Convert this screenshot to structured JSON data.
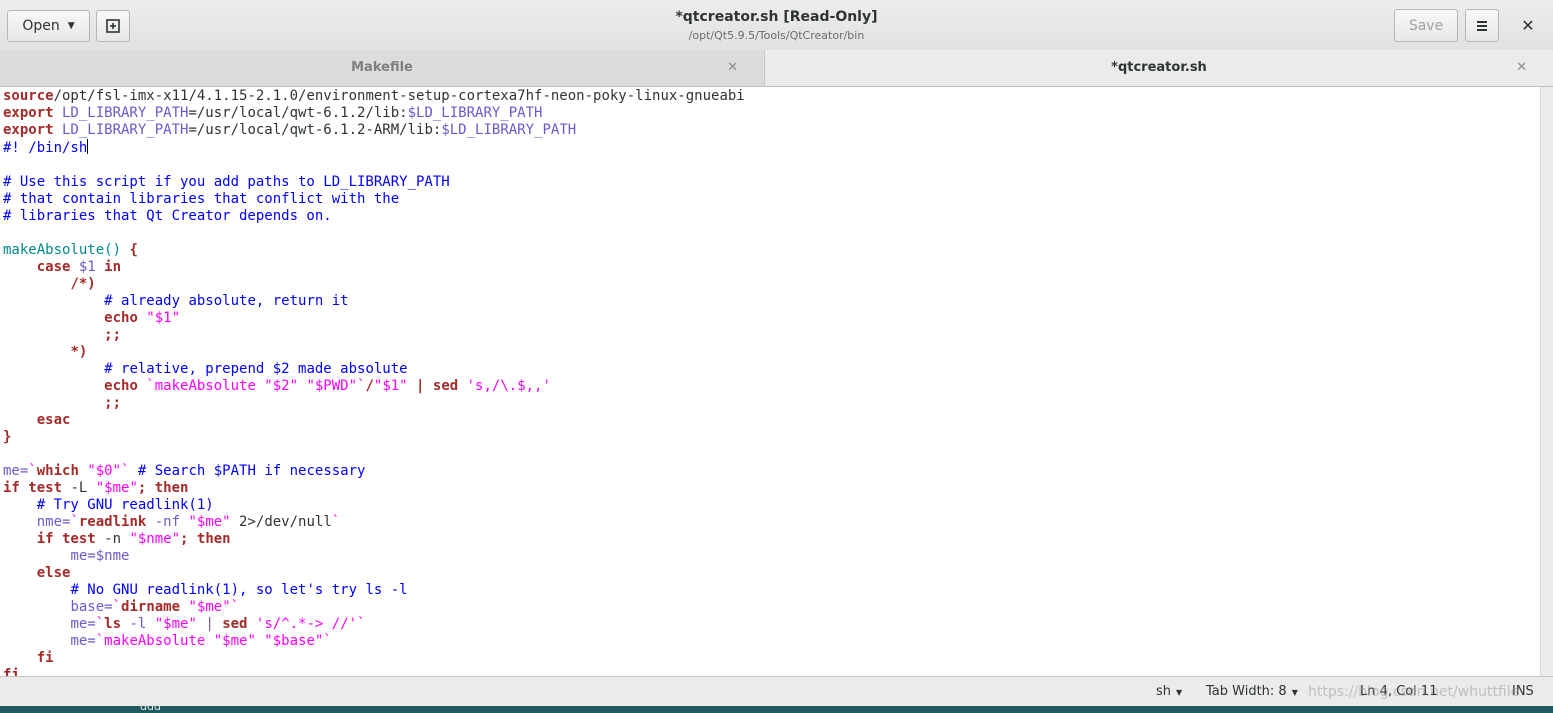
{
  "window": {
    "title": "*qtcreator.sh [Read-Only]",
    "subtitle": "/opt/Qt5.9.5/Tools/QtCreator/bin",
    "open_label": "Open",
    "save_label": "Save",
    "close_symbol": "✕"
  },
  "tabs": [
    {
      "label": "Makefile",
      "active": false
    },
    {
      "label": "*qtcreator.sh",
      "active": true
    }
  ],
  "status": {
    "language": "sh",
    "tab_width": "Tab Width: 8",
    "position": "Ln 4, Col 11",
    "mode": "INS"
  },
  "watermark": "https://blog.csdn.net/whuttfile",
  "desktop_label": "ddd",
  "colors": {
    "keyword": "#a52a2a",
    "comment": "#0000ff",
    "string": "#ff00ff",
    "variable": "#6a5acd",
    "function": "#008a8c"
  },
  "code_lines": [
    [
      [
        "kw",
        "source"
      ],
      [
        "",
        "/opt/fsl-imx-x11/4.1.15-2.1.0/environment-setup-cortexa7hf-neon-poky-linux-gnueabi"
      ]
    ],
    [
      [
        "kw",
        "export"
      ],
      [
        "var",
        " LD_LIBRARY_PATH"
      ],
      [
        "",
        "=/usr/local/qwt-6.1.2/lib:"
      ],
      [
        "var",
        "$LD_LIBRARY_PATH"
      ]
    ],
    [
      [
        "kw",
        "export"
      ],
      [
        "var",
        " LD_LIBRARY_PATH"
      ],
      [
        "",
        "=/usr/local/qwt-6.1.2-ARM/lib:"
      ],
      [
        "var",
        "$LD_LIBRARY_PATH"
      ]
    ],
    [
      [
        "cm",
        "#! /bin/sh"
      ],
      [
        "cursor",
        ""
      ]
    ],
    [],
    [
      [
        "cm",
        "# Use this script if you add paths to LD_LIBRARY_PATH"
      ]
    ],
    [
      [
        "cm",
        "# that contain libraries that conflict with the"
      ]
    ],
    [
      [
        "cm",
        "# libraries that Qt Creator depends on."
      ]
    ],
    [],
    [
      [
        "fn",
        "makeAbsolute() "
      ],
      [
        "kw",
        "{"
      ]
    ],
    [
      [
        "",
        "    "
      ],
      [
        "kw",
        "case"
      ],
      [
        "var",
        " $1"
      ],
      [
        "kw",
        " in"
      ]
    ],
    [
      [
        "",
        "        "
      ],
      [
        "kw",
        "/*)"
      ]
    ],
    [
      [
        "",
        "            "
      ],
      [
        "cm",
        "# already absolute, return it"
      ]
    ],
    [
      [
        "",
        "            "
      ],
      [
        "kw",
        "echo"
      ],
      [
        "str",
        " \"$1\""
      ]
    ],
    [
      [
        "",
        "            "
      ],
      [
        "kw",
        ";;"
      ]
    ],
    [
      [
        "",
        "        "
      ],
      [
        "kw",
        "*)"
      ]
    ],
    [
      [
        "",
        "            "
      ],
      [
        "cm",
        "# relative, prepend $2 made absolute"
      ]
    ],
    [
      [
        "",
        "            "
      ],
      [
        "kw",
        "echo"
      ],
      [
        "str",
        " `makeAbsolute \"$2\" \"$PWD\"`"
      ],
      [
        "kw",
        "/"
      ],
      [
        "str",
        "\"$1\""
      ],
      [
        "kw",
        " | sed"
      ],
      [
        "str",
        " 's,/\\.$,,'"
      ]
    ],
    [
      [
        "",
        "            "
      ],
      [
        "kw",
        ";;"
      ]
    ],
    [
      [
        "",
        "    "
      ],
      [
        "kw",
        "esac"
      ]
    ],
    [
      [
        "kw",
        "}"
      ]
    ],
    [],
    [
      [
        "var",
        "me="
      ],
      [
        "str",
        "`"
      ],
      [
        "kw",
        "which"
      ],
      [
        "str",
        " \"$0\"`"
      ],
      [
        "cm",
        " # Search $PATH if necessary"
      ]
    ],
    [
      [
        "kw",
        "if test"
      ],
      [
        "",
        " -L "
      ],
      [
        "str",
        "\"$me\""
      ],
      [
        "kw",
        "; then"
      ]
    ],
    [
      [
        "",
        "    "
      ],
      [
        "cm",
        "# Try GNU readlink(1)"
      ]
    ],
    [
      [
        "",
        "    "
      ],
      [
        "var",
        "nme="
      ],
      [
        "str",
        "`"
      ],
      [
        "kw",
        "readlink"
      ],
      [
        "var",
        " -nf"
      ],
      [
        "str",
        " \"$me\""
      ],
      [
        "",
        " 2>/dev/null"
      ],
      [
        "str",
        "`"
      ]
    ],
    [
      [
        "",
        "    "
      ],
      [
        "kw",
        "if test"
      ],
      [
        "",
        " -n "
      ],
      [
        "str",
        "\"$nme\""
      ],
      [
        "kw",
        "; then"
      ]
    ],
    [
      [
        "",
        "        "
      ],
      [
        "var",
        "me=$nme"
      ]
    ],
    [
      [
        "",
        "    "
      ],
      [
        "kw",
        "else"
      ]
    ],
    [
      [
        "",
        "        "
      ],
      [
        "cm",
        "# No GNU readlink(1), so let's try ls -l"
      ]
    ],
    [
      [
        "",
        "        "
      ],
      [
        "var",
        "base="
      ],
      [
        "str",
        "`"
      ],
      [
        "kw",
        "dirname"
      ],
      [
        "str",
        " \"$me\"`"
      ]
    ],
    [
      [
        "",
        "        "
      ],
      [
        "var",
        "me="
      ],
      [
        "str",
        "`"
      ],
      [
        "kw",
        "ls"
      ],
      [
        "var",
        " -l"
      ],
      [
        "str",
        " \"$me\""
      ],
      [
        "var",
        " |"
      ],
      [
        "kw",
        " sed"
      ],
      [
        "str",
        " 's/^.*-> //'`"
      ]
    ],
    [
      [
        "",
        "        "
      ],
      [
        "var",
        "me="
      ],
      [
        "str",
        "`makeAbsolute \"$me\" \"$base\"`"
      ]
    ],
    [
      [
        "",
        "    "
      ],
      [
        "kw",
        "fi"
      ]
    ],
    [
      [
        "kw",
        "fi"
      ]
    ]
  ]
}
